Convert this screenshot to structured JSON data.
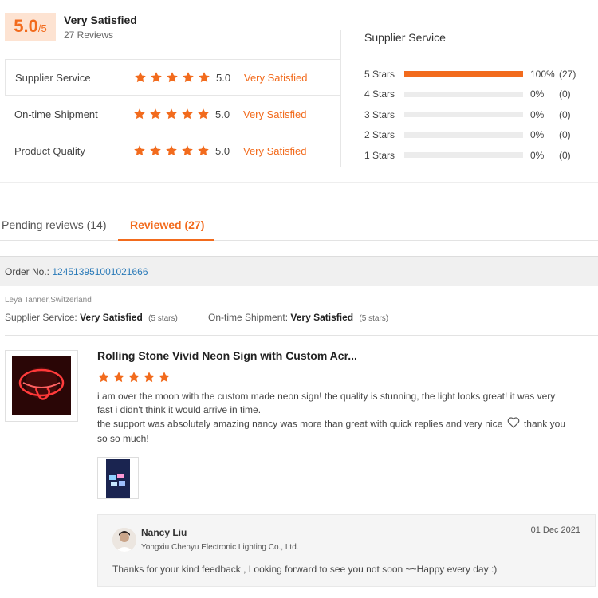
{
  "summary": {
    "score": "5.0",
    "score_max": "/5",
    "overall_label": "Very Satisfied",
    "review_count": "27 Reviews",
    "ratings": [
      {
        "label": "Supplier Service",
        "stars": 5,
        "value": "5.0",
        "verdict": "Very Satisfied"
      },
      {
        "label": "On-time Shipment",
        "stars": 5,
        "value": "5.0",
        "verdict": "Very Satisfied"
      },
      {
        "label": "Product Quality",
        "stars": 5,
        "value": "5.0",
        "verdict": "Very Satisfied"
      }
    ],
    "distribution_title": "Supplier Service",
    "distribution": [
      {
        "label": "5 Stars",
        "fraction": 1.0,
        "pct": "100%",
        "count": "(27)"
      },
      {
        "label": "4 Stars",
        "fraction": 0.0,
        "pct": "0%",
        "count": "(0)"
      },
      {
        "label": "3 Stars",
        "fraction": 0.0,
        "pct": "0%",
        "count": "(0)"
      },
      {
        "label": "2 Stars",
        "fraction": 0.0,
        "pct": "0%",
        "count": "(0)"
      },
      {
        "label": "1 Stars",
        "fraction": 0.0,
        "pct": "0%",
        "count": "(0)"
      }
    ]
  },
  "tabs": {
    "pending": "Pending reviews (14)",
    "reviewed": "Reviewed (27)"
  },
  "order": {
    "label": "Order No.:",
    "number": "124513951001021666"
  },
  "review": {
    "reviewer": "Leya Tanner,Switzerland",
    "supplier_label": "Supplier Service:",
    "supplier_value": "Very Satisfied",
    "supplier_stars": "(5 stars)",
    "shipment_label": "On-time Shipment:",
    "shipment_value": "Very Satisfied",
    "shipment_stars": "(5 stars)",
    "product_title": "Rolling Stone Vivid Neon Sign with Custom Acr...",
    "stars": 5,
    "text_part1": "i am over the moon with the custom made neon sign! the quality is stunning, the light looks great! it was very fast i didn't think it would arrive in time.",
    "text_part2": "the support was absolutely amazing nancy was more than great with quick replies and very nice",
    "text_part3": "thank you so so much!"
  },
  "reply": {
    "name": "Nancy Liu",
    "company": "Yongxiu Chenyu Electronic Lighting Co., Ltd.",
    "date": "01 Dec 2021",
    "text": "Thanks for your kind feedback , Looking forward to see you not soon ~~Happy every day :)"
  },
  "colors": {
    "accent": "#f26b1d",
    "link": "#2a7ab8"
  }
}
